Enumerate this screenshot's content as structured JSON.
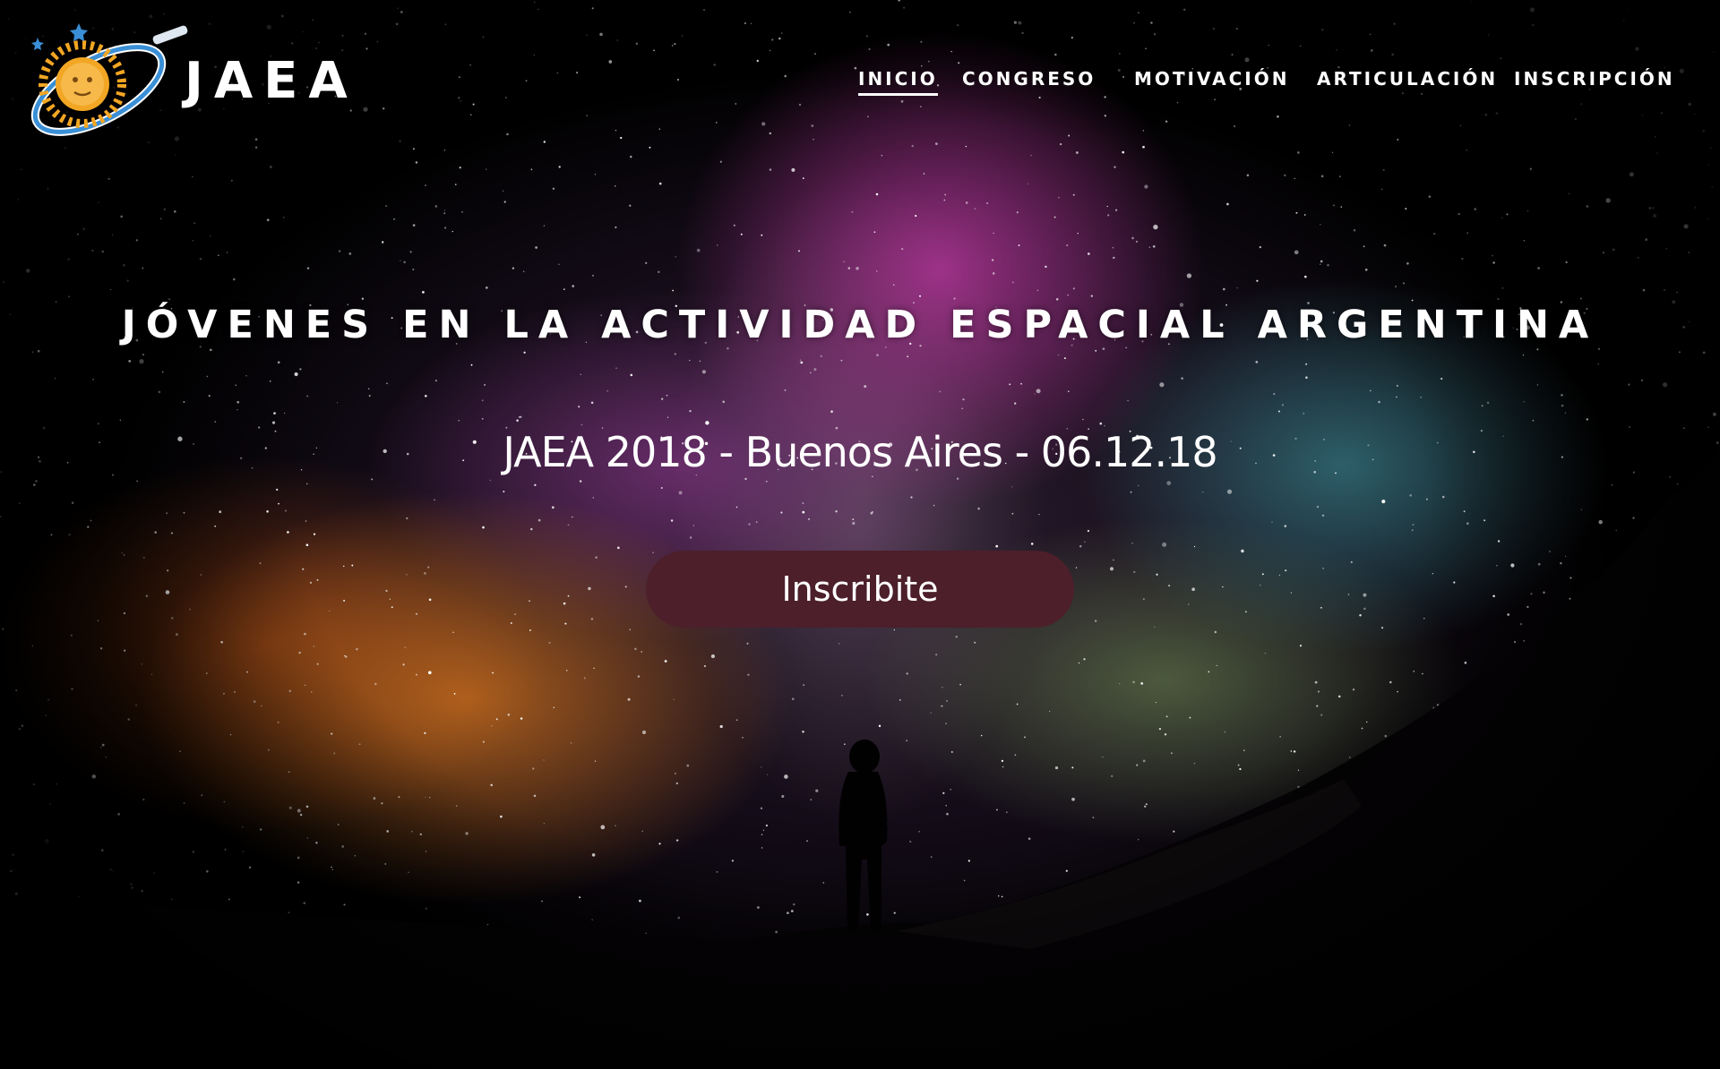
{
  "brand": {
    "name": "JAEA",
    "logo_icon": "argentine-sun-orbit-logo"
  },
  "nav": {
    "items": [
      {
        "label": "INICIO",
        "active": true
      },
      {
        "label": "CONGRESO",
        "active": false
      },
      {
        "label": "MOTIVACIÓN",
        "active": false
      },
      {
        "label": "ARTICULACIÓN",
        "active": false
      },
      {
        "label": "INSCRIPCIÓN",
        "active": false
      }
    ]
  },
  "hero": {
    "title": "JÓVENES EN LA ACTIVIDAD ESPACIAL ARGENTINA",
    "subtitle": "JAEA 2018 - Buenos Aires - 06.12.18",
    "cta_label": "Inscribite",
    "background": "milky-way-night-sky-with-silhouette"
  },
  "colors": {
    "cta_background": "#4c1f2b",
    "text": "#ffffff",
    "logo_blue": "#3a8fd6",
    "logo_sun": "#f2a623"
  }
}
